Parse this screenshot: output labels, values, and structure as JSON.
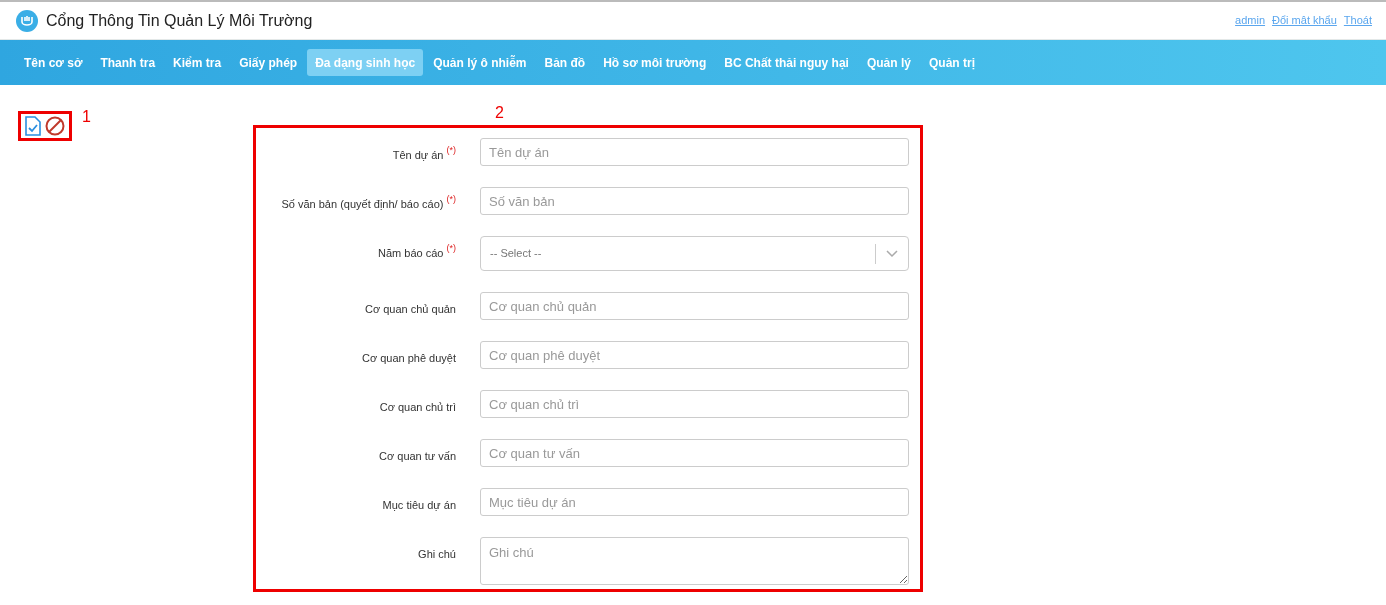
{
  "app": {
    "title": "Cổng Thông Tin Quản Lý Môi Trường"
  },
  "user_links": [
    "admin",
    "Đổi mật khẩu",
    "Thoát"
  ],
  "nav": [
    {
      "label": "Tên cơ sở",
      "selected": false
    },
    {
      "label": "Thanh tra",
      "selected": false
    },
    {
      "label": "Kiểm tra",
      "selected": false
    },
    {
      "label": "Giấy phép",
      "selected": false
    },
    {
      "label": "Đa dạng sinh học",
      "selected": true
    },
    {
      "label": "Quản lý ô nhiễm",
      "selected": false
    },
    {
      "label": "Bản đồ",
      "selected": false
    },
    {
      "label": "Hồ sơ môi trường",
      "selected": false
    },
    {
      "label": "BC Chất thải nguy hại",
      "selected": false
    },
    {
      "label": "Quản lý",
      "selected": false
    },
    {
      "label": "Quản trị",
      "selected": false
    }
  ],
  "annotations": [
    "1",
    "2"
  ],
  "required_mark": "(*)",
  "form": [
    {
      "kind": "text",
      "label": "Tên dự án",
      "required": true,
      "placeholder": "Tên dự án"
    },
    {
      "kind": "text",
      "label": "Số văn bản (quyết định/ báo cáo)",
      "required": true,
      "placeholder": "Số văn bản"
    },
    {
      "kind": "select",
      "label": "Năm báo cáo",
      "required": true,
      "placeholder": "-- Select --"
    },
    {
      "kind": "text",
      "label": "Cơ quan chủ quản",
      "required": false,
      "placeholder": "Cơ quan chủ quản"
    },
    {
      "kind": "text",
      "label": "Cơ quan phê duyệt",
      "required": false,
      "placeholder": "Cơ quan phê duyệt"
    },
    {
      "kind": "text",
      "label": "Cơ quan chủ trì",
      "required": false,
      "placeholder": "Cơ quan chủ trì"
    },
    {
      "kind": "text",
      "label": "Cơ quan tư vấn",
      "required": false,
      "placeholder": "Cơ quan tư vấn"
    },
    {
      "kind": "text",
      "label": "Mục tiêu dự án",
      "required": false,
      "placeholder": "Mục tiêu dự án"
    },
    {
      "kind": "textarea",
      "label": "Ghi chú",
      "required": false,
      "placeholder": "Ghi chú"
    }
  ]
}
